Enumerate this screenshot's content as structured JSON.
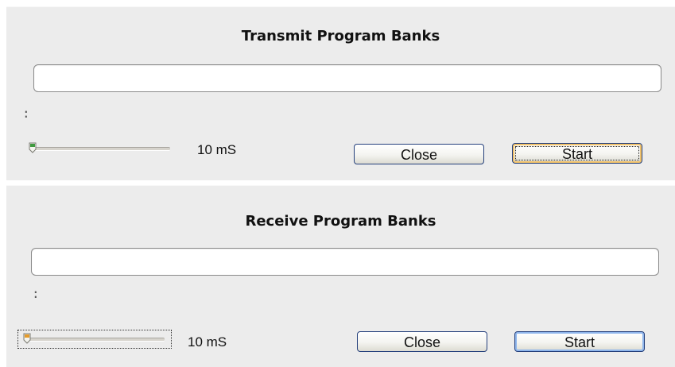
{
  "transmit": {
    "title": "Transmit Program Banks",
    "progress_percent": 0,
    "status_text": ":",
    "delay_value": "10 mS",
    "slider_level": 0,
    "close_label": "Close",
    "start_label": "Start"
  },
  "receive": {
    "title": "Receive Program Banks",
    "progress_percent": 0,
    "status_text": ":",
    "delay_value": "10 mS",
    "slider_level": 0,
    "close_label": "Close",
    "start_label": "Start"
  },
  "colors": {
    "panel_bg": "#ececec",
    "button_border": "#25407c",
    "thumb_green": "#3f9a3f",
    "thumb_orange": "#e59b2b"
  },
  "icons": {
    "transmit_thumb": "slider-thumb-green",
    "receive_thumb": "slider-thumb-orange"
  }
}
